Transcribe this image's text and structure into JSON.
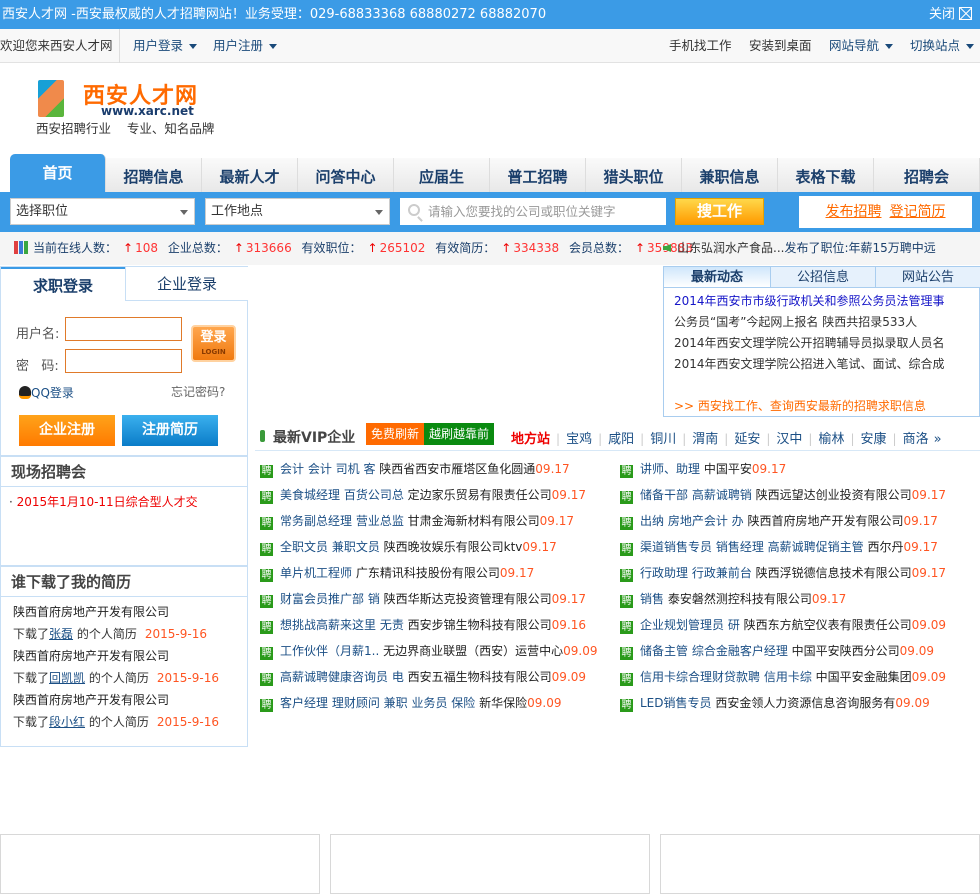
{
  "topbar": {
    "text": "西安人才网 -西安最权威的人才招聘网站！业务受理：029-68833368 68880272 68882070",
    "close": "关闭"
  },
  "subbar": {
    "welcome": "欢迎您来西安人才网",
    "user_login": "用户登录",
    "user_register": "用户注册",
    "mobile": "手机找工作",
    "install": "安装到桌面",
    "site_nav": "网站导航",
    "switch_site": "切换站点"
  },
  "logo": {
    "name": "西安人才网",
    "url": "www.xarc.net",
    "slogan": "西安招聘行业    专业、知名品牌"
  },
  "nav": [
    "首页",
    "招聘信息",
    "最新人才",
    "问答中心",
    "应届生",
    "普工招聘",
    "猎头职位",
    "兼职信息",
    "表格下载",
    "招聘会"
  ],
  "search": {
    "position": "选择职位",
    "location": "工作地点",
    "placeholder": "请输入您要找的公司或职位关键字",
    "button": "搜工作",
    "post_job": "发布招聘",
    "register_resume": "登记简历"
  },
  "stats": {
    "online_label": "当前在线人数：",
    "online": "108",
    "companies_label": "企业总数：",
    "companies": "313666",
    "jobs_label": "有效职位：",
    "jobs": "265102",
    "resumes_label": "有效简历：",
    "resumes": "334338",
    "members_label": "会员总数：",
    "members": "359883",
    "ticker_company": "山东弘润水产食品...",
    "ticker_text": "发布了职位:年薪15万聘中远"
  },
  "login": {
    "tab_jobseeker": "求职登录",
    "tab_company": "企业登录",
    "username_label": "用户名:",
    "password_label": "密   码:",
    "login_btn": "登录",
    "login_sub": "LOGIN",
    "qq": "QQ登录",
    "forgot": "忘记密码?",
    "company_register": "企业注册",
    "resume_register": "注册简历"
  },
  "fairs": {
    "title": "现场招聘会",
    "items": [
      "2015年1月10-11日综合型人才交"
    ]
  },
  "downloads": {
    "title": "谁下载了我的简历",
    "items": [
      {
        "company": "陕西首府房地产开发有限公司",
        "prefix": "下载了",
        "name": "张磊",
        "suffix": " 的个人简历",
        "date": "2015-9-16"
      },
      {
        "company": "陕西首府房地产开发有限公司",
        "prefix": "下载了",
        "name": "回凯凯",
        "suffix": " 的个人简历",
        "date": "2015-9-16"
      },
      {
        "company": "陕西首府房地产开发有限公司",
        "prefix": "下载了",
        "name": "段小红",
        "suffix": " 的个人简历",
        "date": "2015-9-16"
      }
    ]
  },
  "news": {
    "tabs": [
      "最新动态",
      "公招信息",
      "网站公告"
    ],
    "items": [
      "2014年西安市市级行政机关和参照公务员法管理事",
      "公务员“国考”今起网上报名 陕西共招录533人",
      "2014年西安文理学院公开招聘辅导员拟录取人员名",
      "2014年西安文理学院公招进入笔试、面试、综合成"
    ],
    "more": ">> 西安找工作、查询西安最新的招聘求职信息"
  },
  "vip": {
    "title": "最新VIP企业",
    "free_refresh": "免费刷新",
    "refresh_more": "越刷越靠前",
    "local": "地方站",
    "cities": [
      "宝鸡",
      "咸阳",
      "铜川",
      "渭南",
      "延安",
      "汉中",
      "榆林",
      "安康",
      "商洛"
    ],
    "more": "»"
  },
  "jobs_left": [
    {
      "title": "会计 会计 司机 客",
      "company": "陕西省西安市雁塔区鱼化圆通",
      "date": "09.17"
    },
    {
      "title": "美食城经理 百货公司总",
      "company": "定边家乐贸易有限责任公司",
      "date": "09.17"
    },
    {
      "title": "常务副总经理 营业总监",
      "company": "甘肃金海新材料有限公司",
      "date": "09.17"
    },
    {
      "title": "全职文员 兼职文员",
      "company": "陕西晚妆娱乐有限公司ktv",
      "date": "09.17"
    },
    {
      "title": "单片机工程师",
      "company": "广东精讯科技股份有限公司",
      "date": "09.17"
    },
    {
      "title": "财富会员推广部 销",
      "company": "陕西华斯达克投资管理有限公司",
      "date": "09.17"
    },
    {
      "title": "想挑战高薪来这里 无责",
      "company": "西安步锦生物科技有限公司",
      "date": "09.16"
    },
    {
      "title": "工作伙伴（月薪1..",
      "company": "无边界商业联盟（西安）运营中心",
      "date": "09.09"
    },
    {
      "title": "高薪诚聘健康咨询员 电",
      "company": "西安五福生物科技有限公司",
      "date": "09.09"
    },
    {
      "title": "客户经理 理财顾问 兼职 业务员 保险",
      "company": "新华保险",
      "date": "09.09"
    }
  ],
  "jobs_right": [
    {
      "title": "讲师、助理",
      "company": "中国平安",
      "date": "09.17"
    },
    {
      "title": "储备干部 高薪诚聘销",
      "company": "陕西远望达创业投资有限公司",
      "date": "09.17"
    },
    {
      "title": "出纳 房地产会计 办",
      "company": "陕西首府房地产开发有限公司",
      "date": "09.17"
    },
    {
      "title": "渠道销售专员 销售经理 高薪诚聘促销主管",
      "company": "西尔丹",
      "date": "09.17"
    },
    {
      "title": "行政助理 行政兼前台",
      "company": "陕西浮锐德信息技术有限公司",
      "date": "09.17"
    },
    {
      "title": "销售",
      "company": "泰安磐然测控科技有限公司",
      "date": "09.17"
    },
    {
      "title": "企业规划管理员 研",
      "company": "陕西东方航空仪表有限责任公司",
      "date": "09.09"
    },
    {
      "title": "储备主管 综合金融客户经理",
      "company": "中国平安陕西分公司",
      "date": "09.09"
    },
    {
      "title": "信用卡综合理财贷款聘 信用卡综",
      "company": "中国平安金融集团",
      "date": "09.09"
    },
    {
      "title": "LED销售专员",
      "company": "西安金领人力资源信息咨询服务有",
      "date": "09.09"
    }
  ],
  "colors": {
    "brand_blue": "#3b9be6",
    "orange": "#ff6a00",
    "green": "#2a9a1a",
    "date_red": "#ff5522"
  }
}
